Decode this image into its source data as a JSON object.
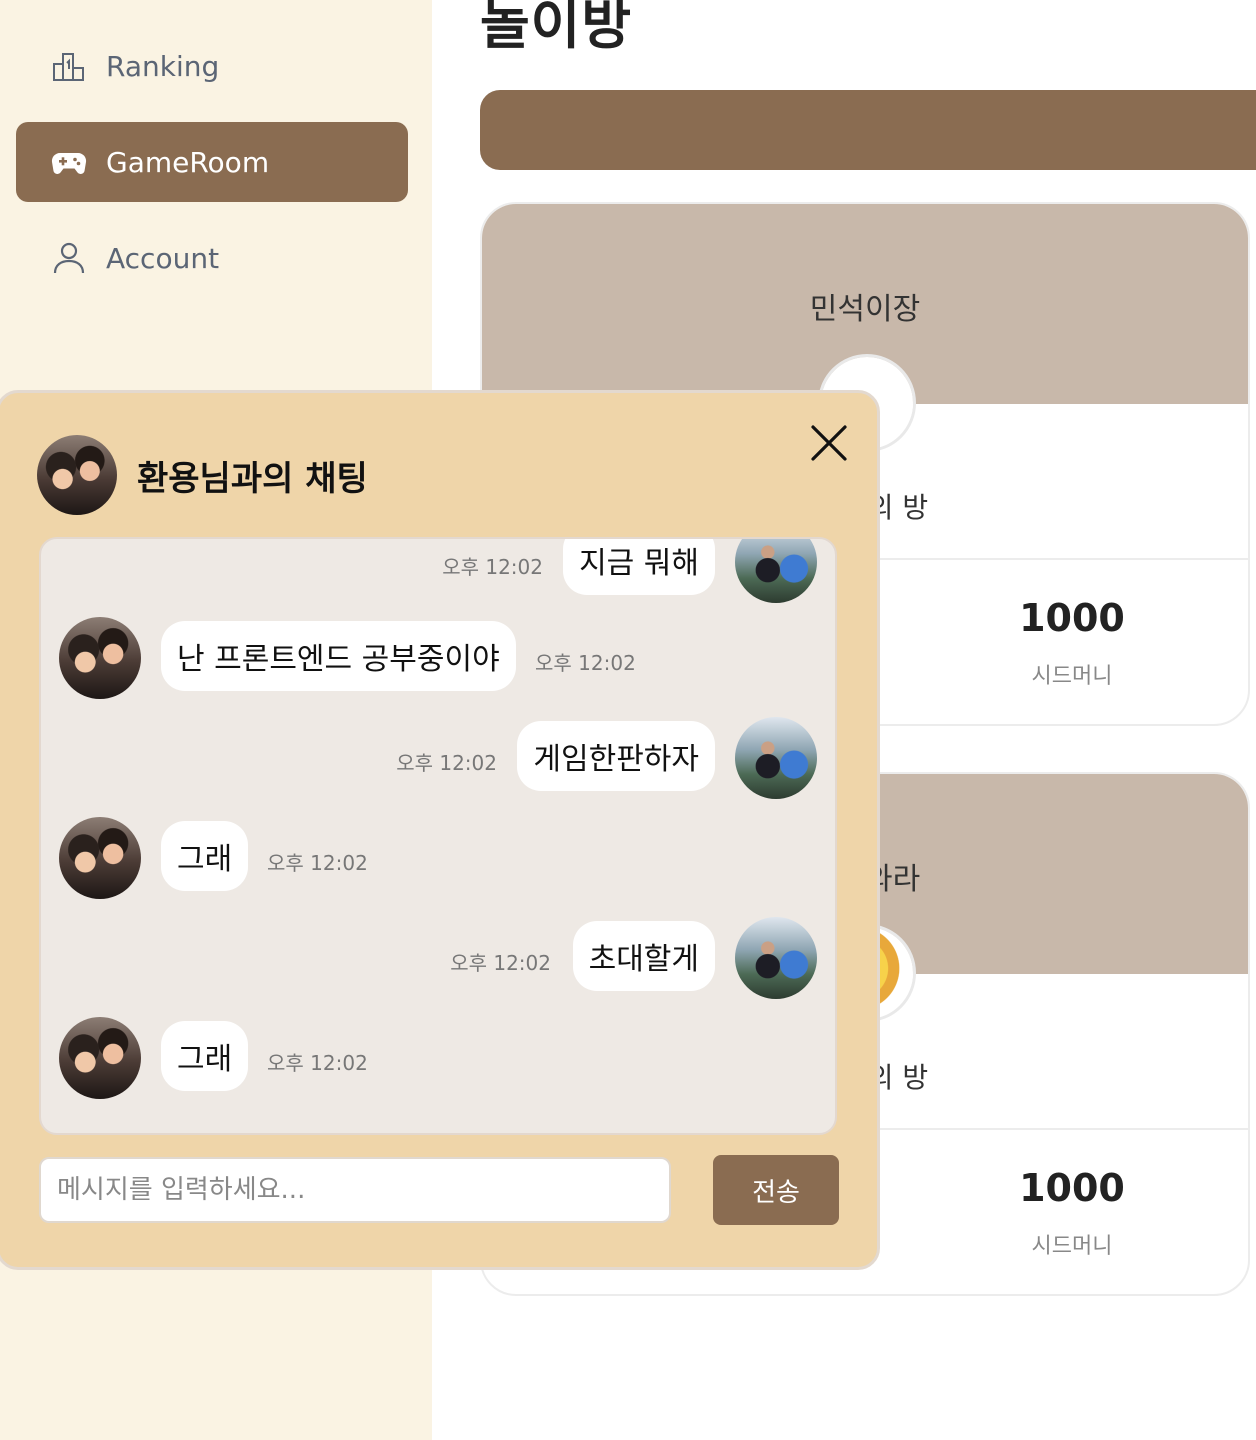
{
  "sidebar": {
    "items": [
      {
        "label": "Ranking",
        "icon": "ranking-icon",
        "active": false
      },
      {
        "label": "GameRoom",
        "icon": "gamepad-icon",
        "active": true
      },
      {
        "label": "Account",
        "icon": "user-icon",
        "active": false
      }
    ]
  },
  "main": {
    "title": "놀이방",
    "rooms": [
      {
        "name": "민석이장",
        "owner": "님의 방",
        "money": "1000",
        "money_label": "시드머니"
      },
      {
        "name": "들어와라",
        "owner": "님의 방",
        "money": "1000",
        "money_label": "시드머니"
      }
    ]
  },
  "chat": {
    "title": "환용님과의 채팅",
    "messages": [
      {
        "side": "right",
        "text": "지금 뭐해",
        "time": "오후 12:02"
      },
      {
        "side": "left",
        "text": "난 프론트엔드 공부중이야",
        "time": "오후 12:02"
      },
      {
        "side": "right",
        "text": "게임한판하자",
        "time": "오후 12:02"
      },
      {
        "side": "left",
        "text": "그래",
        "time": "오후 12:02"
      },
      {
        "side": "right",
        "text": "초대할게",
        "time": "오후 12:02"
      },
      {
        "side": "left",
        "text": "그래",
        "time": "오후 12:02"
      }
    ],
    "input_placeholder": "메시지를 입력하세요...",
    "send_label": "전송"
  },
  "colors": {
    "accent": "#8a6c51",
    "sidebar_bg": "#faf3e3",
    "chat_bg": "#efd5a9",
    "card_top": "#c8b8aa"
  }
}
